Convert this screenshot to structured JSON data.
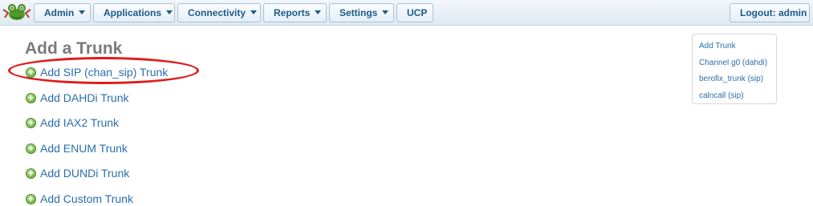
{
  "menu": {
    "admin": "Admin",
    "applications": "Applications",
    "connectivity": "Connectivity",
    "reports": "Reports",
    "settings": "Settings",
    "ucp": "UCP",
    "logout": "Logout: admin"
  },
  "page": {
    "title": "Add a Trunk",
    "trunk_types": [
      "Add SIP (chan_sip) Trunk",
      "Add DAHDi Trunk",
      "Add IAX2 Trunk",
      "Add ENUM Trunk",
      "Add DUNDi Trunk",
      "Add Custom Trunk"
    ],
    "highlighted_item": "Add SIP (chan_sip) Trunk"
  },
  "side_panel": {
    "items": [
      "Add Trunk",
      "Channel g0 (dahdi)",
      "berofix_trunk (sip)",
      "calncall (sip)"
    ]
  },
  "colors": {
    "link": "#2a6eab",
    "menu_text": "#1c5a8a",
    "highlight_oval": "#e01b1b",
    "add_icon": "#56a22c"
  },
  "icons": {
    "logo": "freepbx-frog-logo",
    "add": "green-plus-circle-icon",
    "dropdown": "caret-down-icon"
  }
}
